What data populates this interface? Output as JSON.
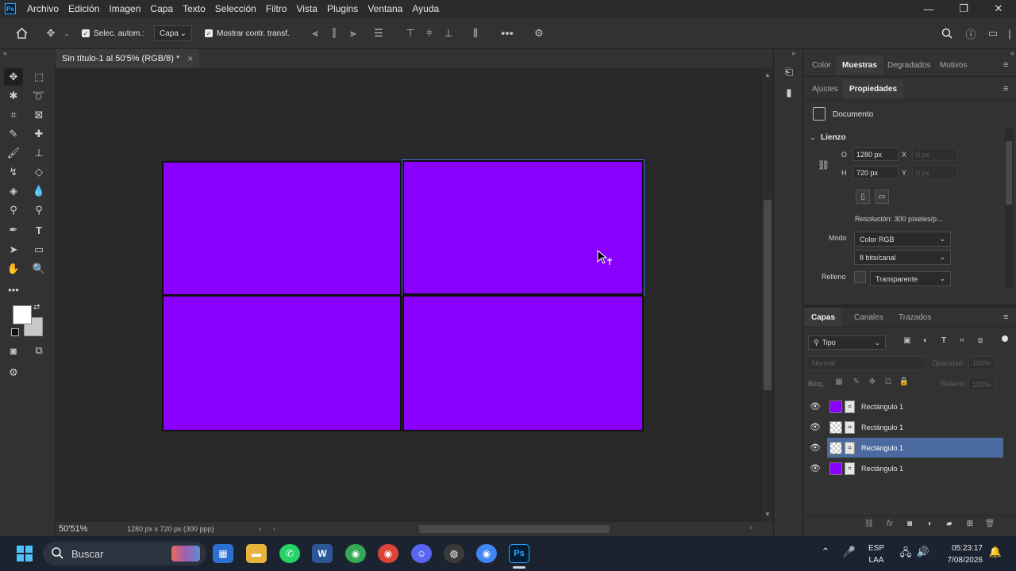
{
  "menubar": {
    "app_icon": "Ps",
    "items": [
      "Archivo",
      "Edición",
      "Imagen",
      "Capa",
      "Texto",
      "Selección",
      "Filtro",
      "Vista",
      "Plugins",
      "Ventana",
      "Ayuda"
    ],
    "window_controls": [
      "minimize-icon",
      "restore-icon",
      "close-icon"
    ]
  },
  "optionsbar": {
    "auto_select_label": "Selec. autom.:",
    "auto_select_checked": true,
    "auto_select_target": "Capa",
    "show_transform_label": "Mostrar contr. transf.",
    "show_transform_checked": true
  },
  "document_tab": {
    "title": "Sin título-1 al 50'5% (RGB/8) *",
    "close": "×"
  },
  "statusbar": {
    "zoom": "50'51%",
    "doc_info": "1280 px x 720 px (300 ppp)"
  },
  "canvas": {
    "rectangle_color": "#8a00ff",
    "background": "#282828"
  },
  "properties_panel": {
    "top_tabs": [
      "Color",
      "Muestras",
      "Degradados",
      "Motivos"
    ],
    "top_tab_active": "Muestras",
    "second_tabs": [
      "Ajustes",
      "Propiedades"
    ],
    "second_tab_active": "Propiedades",
    "document_label": "Documento",
    "section_title": "Lienzo",
    "width_label": "O",
    "width_value": "1280 px",
    "height_label": "H",
    "height_value": "720 px",
    "x_label": "X",
    "x_placeholder": "0 px",
    "y_label": "Y",
    "y_placeholder": "0 px",
    "resolution": "Resolución:  300 píxeles/p...",
    "mode_label": "Modo",
    "mode_value": "Color RGB",
    "bits_value": "8 bits/canal",
    "fill_label": "Relleno",
    "fill_value": "Transparente"
  },
  "layers_panel": {
    "tabs": [
      "Capas",
      "Canales",
      "Trazados"
    ],
    "tab_active": "Capas",
    "filter_kind": "Tipo",
    "blend_mode": "Normal",
    "opacity_label": "Opacidad:",
    "opacity_value": "100%",
    "lock_label": "Bloq.:",
    "fill_label": "Relleno:",
    "fill_value": "100%",
    "layers": [
      {
        "name": "Rectángulo 1",
        "thumb": "purple",
        "selected": false
      },
      {
        "name": "Rectángulo 1",
        "thumb": "checker",
        "selected": false
      },
      {
        "name": "Rectángulo 1",
        "thumb": "checker",
        "selected": true
      },
      {
        "name": "Rectángulo 1",
        "thumb": "purple",
        "selected": false
      }
    ]
  },
  "taskbar": {
    "search_placeholder": "Buscar",
    "language": "ESP",
    "keyboard": "LAA",
    "time": "05:23:17",
    "date": "7/08/2026"
  }
}
